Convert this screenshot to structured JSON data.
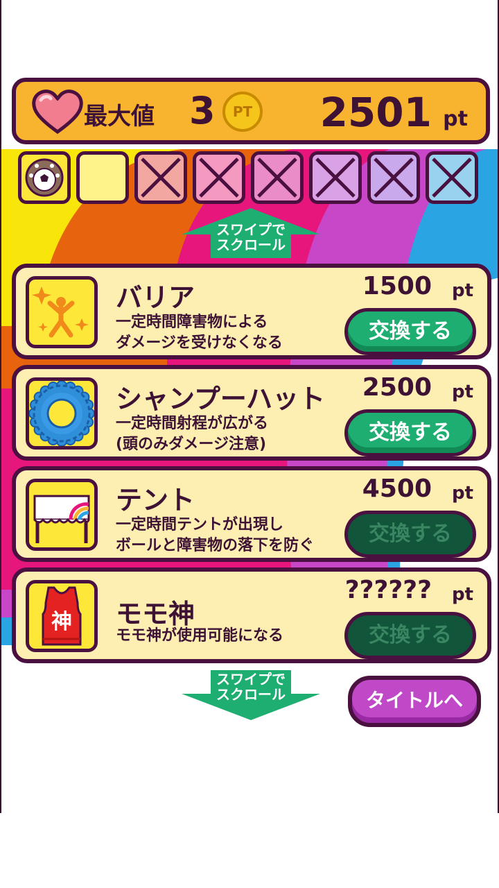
{
  "colors": {
    "outline": "#4a1140",
    "header_bg": "#f8b42e",
    "card_bg": "#fdeeb2",
    "exchange_enabled": "#1fae72",
    "exchange_disabled": "#11553a",
    "title_button": "#bf49c6",
    "swipe_arrow": "#1fae72"
  },
  "header": {
    "max_label": "最大値",
    "max_value": "3",
    "coin_label": "PT",
    "points": "2501",
    "points_unit": "pt"
  },
  "slots": [
    {
      "state": "item",
      "icon": "soccer-ball-icon",
      "color": "#fde83a"
    },
    {
      "state": "empty",
      "icon": "",
      "color": "#fef28a"
    },
    {
      "state": "locked",
      "icon": "x-mark-icon",
      "color": "#f2a8a0"
    },
    {
      "state": "locked",
      "icon": "x-mark-icon",
      "color": "#f49ac0"
    },
    {
      "state": "locked",
      "icon": "x-mark-icon",
      "color": "#ea8cc8"
    },
    {
      "state": "locked",
      "icon": "x-mark-icon",
      "color": "#d9a2e6"
    },
    {
      "state": "locked",
      "icon": "x-mark-icon",
      "color": "#c9a8ec"
    },
    {
      "state": "locked",
      "icon": "x-mark-icon",
      "color": "#99d2ef"
    }
  ],
  "swipe_hint_top": [
    "スワイプで",
    "スクロール"
  ],
  "swipe_hint_bottom": [
    "スワイプで",
    "スクロール"
  ],
  "items": [
    {
      "name": "バリア",
      "desc1": "一定時間障害物による",
      "desc2": "ダメージを受けなくなる",
      "price": "1500",
      "unit": "pt",
      "button": "交換する",
      "enabled": true,
      "icon": "barrier-icon"
    },
    {
      "name": "シャンプーハット",
      "desc1": "一定時間射程が広がる",
      "desc2": "(頭のみダメージ注意)",
      "price": "2500",
      "unit": "pt",
      "button": "交換する",
      "enabled": true,
      "icon": "shampoo-hat-icon"
    },
    {
      "name": "テント",
      "desc1": "一定時間テントが出現し",
      "desc2": "ボールと障害物の落下を防ぐ",
      "price": "4500",
      "unit": "pt",
      "button": "交換する",
      "enabled": false,
      "icon": "tent-icon"
    },
    {
      "name": "モモ神",
      "desc1": "モモ神が使用可能になる",
      "desc2": "",
      "price": "??????",
      "unit": "pt",
      "button": "交換する",
      "enabled": false,
      "icon": "momo-god-jersey-icon",
      "jersey_text": "神"
    }
  ],
  "title_button": "タイトルへ"
}
